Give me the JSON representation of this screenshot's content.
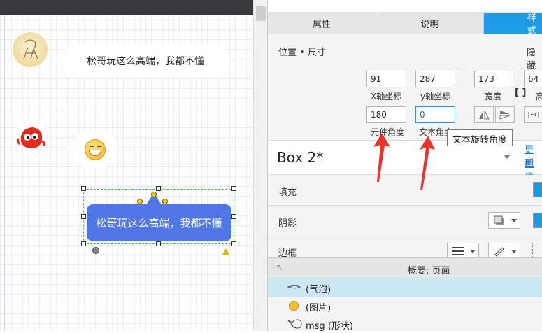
{
  "canvas": {
    "bubble1_text": "松哥玩这么高端，我都不懂",
    "selected_text": "松哥玩这么高端，我都不懂"
  },
  "tabs": [
    {
      "label": "属性"
    },
    {
      "label": "说明"
    },
    {
      "label": "样式"
    }
  ],
  "position": {
    "title": "位置 • 尺寸",
    "hide_label": "隐藏",
    "x": "91",
    "y": "287",
    "width": "173",
    "height": "64",
    "x_label": "X轴坐标",
    "y_label": "y轴坐标",
    "width_label": "宽度",
    "height_label": "高",
    "rotation": "180",
    "text_rotation": "0",
    "rotation_label": "元件角度",
    "text_rotation_label": "文本角度"
  },
  "tooltip": "文本旋转角度",
  "style_name": "Box 2*",
  "links": {
    "update": "更新",
    "create": "创建"
  },
  "sections": {
    "fill": "填充",
    "shadow": "阴影",
    "border": "边框"
  },
  "summary": {
    "title": "概要: 页面"
  },
  "tree": [
    {
      "label": "(气泡)"
    },
    {
      "label": "(图片)"
    },
    {
      "label": "msg (形状)"
    }
  ],
  "colors": {
    "accent": "#1e9be6",
    "selected_shape": "#4f77e6",
    "arrow": "#e8332c"
  }
}
